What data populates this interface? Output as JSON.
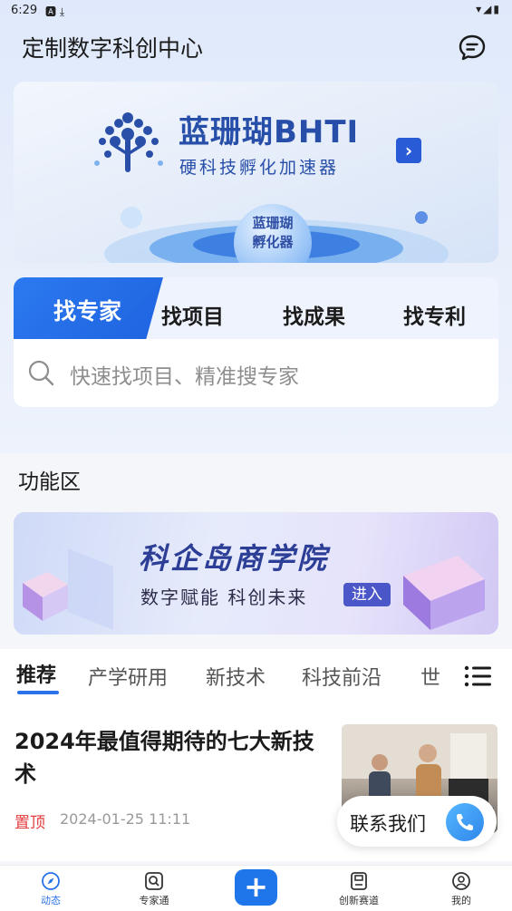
{
  "status_bar": {
    "time": "6:29",
    "left_icons": "🅰 ⤓",
    "right_icons": "▾◢▮"
  },
  "header": {
    "title": "定制数字科创中心",
    "message_icon": "chat-bubble-icon"
  },
  "banner": {
    "title": "蓝珊瑚BHTI",
    "subtitle": "硬科技孵化加速器",
    "arrow": "›",
    "badge_line1": "蓝珊瑚",
    "badge_line2": "孵化器"
  },
  "search": {
    "tabs": [
      "找专家",
      "找项目",
      "找成果",
      "找专利"
    ],
    "active_tab": 0,
    "placeholder": "快速找项目、精准搜专家"
  },
  "features": {
    "section_title": "功能区",
    "academy_title": "科企岛商学院",
    "academy_subtitle": "数字赋能 科创未来",
    "academy_button": "进入"
  },
  "categories": {
    "items": [
      "推荐",
      "产学研用",
      "新技术",
      "科技前沿",
      "世"
    ],
    "active": 0
  },
  "article": {
    "title": "2024年最值得期待的七大新技术",
    "pin": "置顶",
    "date": "2024-01-25 11:11"
  },
  "contact": {
    "label": "联系我们"
  },
  "bottom_nav": {
    "items": [
      {
        "label": "动态",
        "icon": "compass-icon",
        "active": true
      },
      {
        "label": "专家通",
        "icon": "search-box-icon",
        "active": false
      },
      {
        "label": "+",
        "icon": "add-icon",
        "active": false
      },
      {
        "label": "创新赛道",
        "icon": "save-icon",
        "active": false
      },
      {
        "label": "我的",
        "icon": "profile-icon",
        "active": false
      }
    ]
  },
  "colors": {
    "accent": "#2a72ea",
    "banner_text": "#274ea8",
    "pin": "#e43c3c"
  }
}
